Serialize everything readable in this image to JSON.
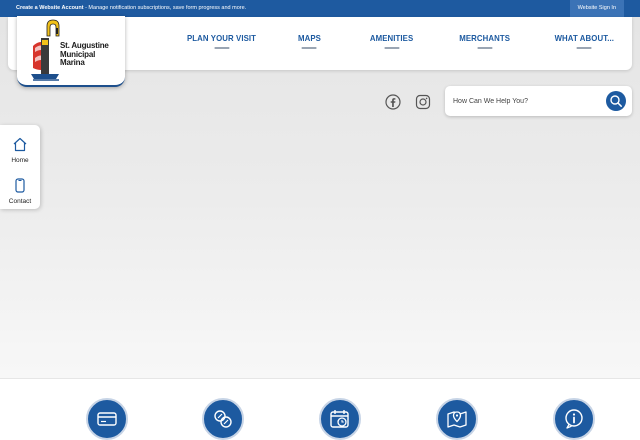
{
  "topbar": {
    "promo_bold": "Create a Website Account",
    "promo_rest": " - Manage notification subscriptions, save form progress and more.",
    "signin_label": "Website Sign In"
  },
  "logo": {
    "lines": [
      "St. Augustine",
      "Municipal",
      "Marina"
    ]
  },
  "nav": {
    "items": [
      "PLAN YOUR VISIT",
      "MAPS",
      "AMENITIES",
      "MERCHANTS",
      "WHAT ABOUT..."
    ]
  },
  "social": {
    "facebook_icon": "facebook-icon",
    "instagram_icon": "instagram-icon"
  },
  "search": {
    "placeholder": "How Can We Help You?",
    "icon": "search-icon"
  },
  "side_tab": {
    "items": [
      {
        "label": "Home",
        "icon": "home-icon"
      },
      {
        "label": "Contact",
        "icon": "phone-icon"
      }
    ]
  },
  "quick_links": {
    "icons": [
      "credit-card-icon",
      "coins-icon",
      "calendar-clock-icon",
      "map-pin-icon",
      "info-chat-icon"
    ]
  },
  "colors": {
    "primary": "#1d5aa0",
    "topbar": "#1e5aa0",
    "signin_bg": "#3b73b6"
  }
}
